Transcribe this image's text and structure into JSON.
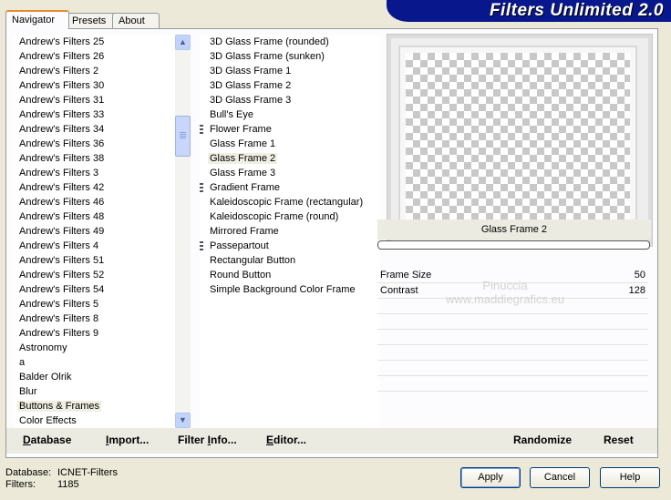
{
  "tabs": [
    "Navigator",
    "Presets",
    "About"
  ],
  "banner": "Filters Unlimited 2.0",
  "categories": {
    "items": [
      "Andrew's Filters 25",
      "Andrew's Filters 26",
      "Andrew's Filters 2",
      "Andrew's Filters 30",
      "Andrew's Filters 31",
      "Andrew's Filters 33",
      "Andrew's Filters 34",
      "Andrew's Filters 36",
      "Andrew's Filters 38",
      "Andrew's Filters 3",
      "Andrew's Filters 42",
      "Andrew's Filters 46",
      "Andrew's Filters 48",
      "Andrew's Filters 49",
      "Andrew's Filters 4",
      "Andrew's Filters 51",
      "Andrew's Filters 52",
      "Andrew's Filters 54",
      "Andrew's Filters 5",
      "Andrew's Filters 8",
      "Andrew's Filters 9",
      "Astronomy",
      "a",
      "Balder Olrik",
      "Blur",
      "Buttons & Frames",
      "Color Effects"
    ],
    "selected": "Buttons & Frames"
  },
  "filters": {
    "items": [
      {
        "label": "3D Glass Frame (rounded)",
        "grip": false
      },
      {
        "label": "3D Glass Frame (sunken)",
        "grip": false
      },
      {
        "label": "3D Glass Frame 1",
        "grip": false
      },
      {
        "label": "3D Glass Frame 2",
        "grip": false
      },
      {
        "label": "3D Glass Frame 3",
        "grip": false
      },
      {
        "label": "Bull's Eye",
        "grip": false
      },
      {
        "label": "Flower Frame",
        "grip": true
      },
      {
        "label": "Glass Frame 1",
        "grip": false
      },
      {
        "label": "Glass Frame 2",
        "grip": false
      },
      {
        "label": "Glass Frame 3",
        "grip": false
      },
      {
        "label": "Gradient Frame",
        "grip": true
      },
      {
        "label": "Kaleidoscopic Frame (rectangular)",
        "grip": false
      },
      {
        "label": "Kaleidoscopic Frame (round)",
        "grip": false
      },
      {
        "label": "Mirrored Frame",
        "grip": false
      },
      {
        "label": "Passepartout",
        "grip": true
      },
      {
        "label": "Rectangular Button",
        "grip": false
      },
      {
        "label": "Round Button",
        "grip": false
      },
      {
        "label": "Simple Background Color Frame",
        "grip": false
      }
    ],
    "selected": "Glass Frame 2"
  },
  "preview": {
    "filter_name": "Glass Frame 2"
  },
  "params": [
    {
      "label": "Frame Size",
      "value": "50"
    },
    {
      "label": "Contrast",
      "value": "128"
    }
  ],
  "watermark": {
    "line1": "Pinuccia",
    "line2": "www.maddiegrafics.eu"
  },
  "toolbar": {
    "database": {
      "first": "D",
      "rest": "atabase"
    },
    "import": {
      "first": "I",
      "rest": "mport..."
    },
    "filter_info": {
      "pre": "Filter ",
      "first": "I",
      "rest": "nfo..."
    },
    "editor": {
      "first": "E",
      "rest": "ditor..."
    },
    "randomize": "Randomize",
    "reset": "Reset"
  },
  "status": {
    "database_label": "Database:",
    "database_value": "ICNET-Filters",
    "filters_label": "Filters:",
    "filters_value": "1185"
  },
  "buttons": {
    "apply": "Apply",
    "cancel": "Cancel",
    "help": "Help"
  },
  "icons": {
    "scroll_up": "chevron-up-icon",
    "scroll_down": "chevron-down-icon"
  }
}
